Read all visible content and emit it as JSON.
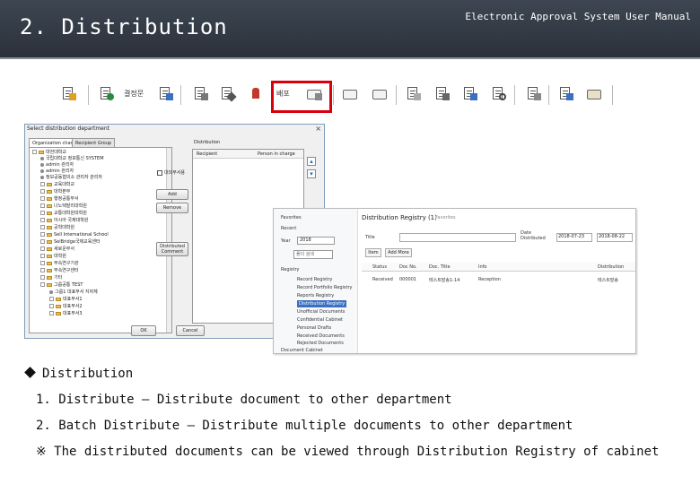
{
  "header": {
    "slide_title": "2. Distribution",
    "manual_title": "Electronic Approval System User Manual"
  },
  "toolbar": {
    "text_1": "결정문",
    "highlighted_label": "배포",
    "highlight_color": "#d8000c"
  },
  "dialog": {
    "title": "Select distribution department",
    "close": "×",
    "tabs": [
      "Organization chart",
      "Recipient Group"
    ],
    "tree_items": [
      "대전대학교",
      "국립대학교 정보통신 SYSTEM",
      "admin 관리자",
      "admin 관리자",
      "정보공동협의소 관리자 관리자",
      "교육대학교",
      "대학본부",
      "행정공통부서",
      "나노텍발리대학원",
      "교통대학원대학원",
      "아시아 국제대학원",
      "공학대학원",
      "Sell International School",
      "SelBridge국제교육센터",
      "새로운부서",
      "대학원",
      "부속연구기관",
      "부속연구센터",
      "기타",
      "그룹공통 TEST",
      "그룹1 대표부서 지자체",
      "대표부서1",
      "대표부서2",
      "대표부서3"
    ],
    "checkbox_label": "대외부서용",
    "distribution_label": "Distribution",
    "columns": [
      "Recipient",
      "Person in charge"
    ],
    "add_button": "Add",
    "remove_button": "Remove",
    "comment_button": "Distributed Comment",
    "ok_button": "OK",
    "cancel_button": "Cancel"
  },
  "registry_window": {
    "favorites": "Favorites",
    "recent": "Recent",
    "year_label": "Year",
    "year_value": "2018",
    "search_placeholder": "폴더 검색",
    "title": "Distribution Registry (1)",
    "favorites_tag": "Favorites",
    "title_label": "Title",
    "date_label": "Date Distributed",
    "date_from": "2018-07-23",
    "date_to": "2018-08-22",
    "btn_1": "Item",
    "btn_2": "Add More",
    "columns": [
      "Status",
      "Doc No.",
      "Doc. Title",
      "Info",
      "Distribution"
    ],
    "row": [
      "Received",
      "000001",
      "테스트발송1-14",
      "Reception",
      "테스트발송"
    ],
    "tree": [
      "Registry",
      "Record Registry",
      "Record Portfolio Registry",
      "Reports Registry",
      "Distribution Registry",
      "Unofficial Documents",
      "Confidential Cabinet",
      "Personal Drafts",
      "Received Documents",
      "Rejected Documents",
      "Document Cabinet"
    ],
    "highlight_color": "#3a6fc4"
  },
  "body": {
    "section_title": "Distribution",
    "line_1": "1. Distribute – Distribute document to other department",
    "line_2": "2. Batch Distribute – Distribute multiple documents to other department",
    "note": "※ The distributed documents can be viewed through Distribution Registry of cabinet"
  }
}
